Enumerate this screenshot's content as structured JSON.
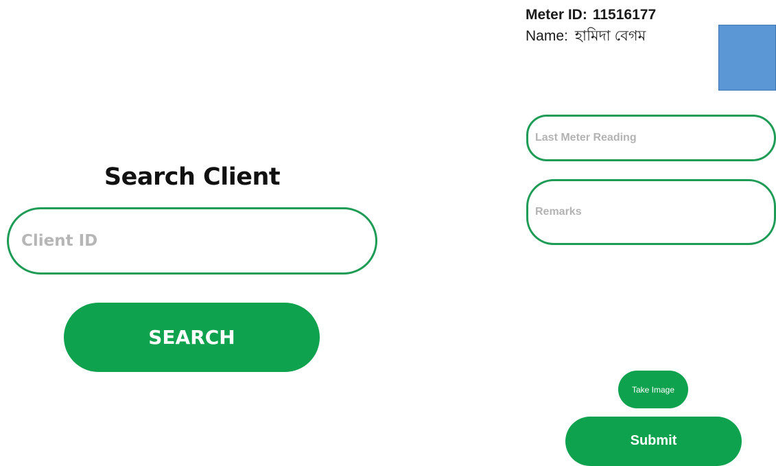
{
  "search_screen": {
    "title": "Search Client",
    "client_id_placeholder": "Client ID",
    "client_id_value": "",
    "search_button_label": "SEARCH"
  },
  "meter_screen": {
    "meter_id_label": "Meter ID:",
    "meter_id_value": "11516177",
    "name_label": "Name:",
    "name_value": "হামিদা বেগম",
    "last_meter_reading_placeholder": "Last Meter Reading",
    "remarks_placeholder": "Remarks",
    "take_image_label": "Take Image",
    "submit_label": "Submit"
  },
  "colors": {
    "accent_green": "#0ea24e",
    "field_border": "#1e9b55",
    "photo_placeholder": "#5b97d5"
  }
}
